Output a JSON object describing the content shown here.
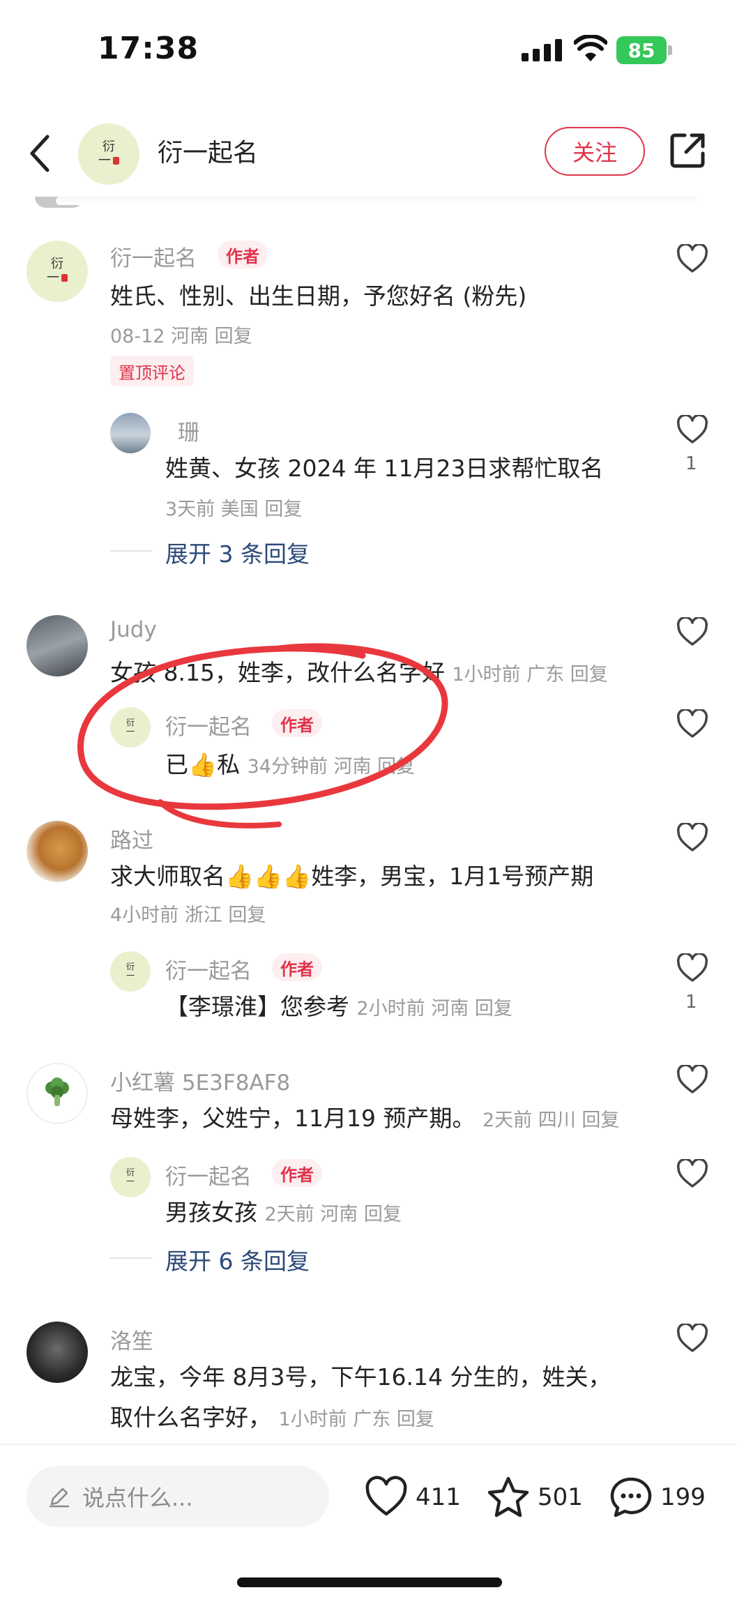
{
  "status_bar": {
    "time": "17:38",
    "battery": "85"
  },
  "header": {
    "title": "衍一起名",
    "follow_label": "关注",
    "avatar_text_top": "衍",
    "avatar_text_bottom": "一"
  },
  "comments": [
    {
      "user": "衍一起名",
      "badge": "作者",
      "text": "姓氏、性别、出生日期，予您好名 (粉先)",
      "meta": "08-12 河南 回复",
      "pin": "置顶评论",
      "replies": [
        {
          "user": "珊",
          "text": "姓黄、女孩 2024 年 11月23日求帮忙取名",
          "meta": "3天前 美国 回复",
          "likes": "1"
        }
      ],
      "expand": "展开 3 条回复"
    },
    {
      "user": "Judy",
      "text": "女孩 8.15，姓李，改什么名字好",
      "meta": "1小时前 广东 回复",
      "replies": [
        {
          "user": "衍一起名",
          "badge": "作者",
          "text": "已👍私",
          "meta": "34分钟前 河南 回复"
        }
      ]
    },
    {
      "user": "路过",
      "text": "求大师取名👍👍👍姓李，男宝，1月1号预产期",
      "meta": "4小时前 浙江 回复",
      "replies": [
        {
          "user": "衍一起名",
          "badge": "作者",
          "text": "【李璟淮】您参考",
          "meta": "2小时前 河南 回复",
          "likes": "1"
        }
      ]
    },
    {
      "user": "小红薯 5E3F8AF8",
      "text": "母姓李，父姓宁，11月19 预产期。",
      "meta": "2天前 四川 回复",
      "replies": [
        {
          "user": "衍一起名",
          "badge": "作者",
          "text": "男孩女孩",
          "meta": "2天前 河南 回复"
        }
      ],
      "expand": "展开 6 条回复"
    },
    {
      "user": "洛笙",
      "text": "龙宝，今年 8月3号，下午16.14 分生的，姓关，",
      "text2": "取什么名字好，",
      "meta": "1小时前 广东 回复"
    }
  ],
  "bottom_bar": {
    "input_placeholder": "说点什么...",
    "likes": "411",
    "stars": "501",
    "comments": "199"
  },
  "colors": {
    "accent": "#e0344b",
    "link": "#2c4a7a",
    "meta": "#9a9a9a",
    "annotation": "#e8383d"
  }
}
